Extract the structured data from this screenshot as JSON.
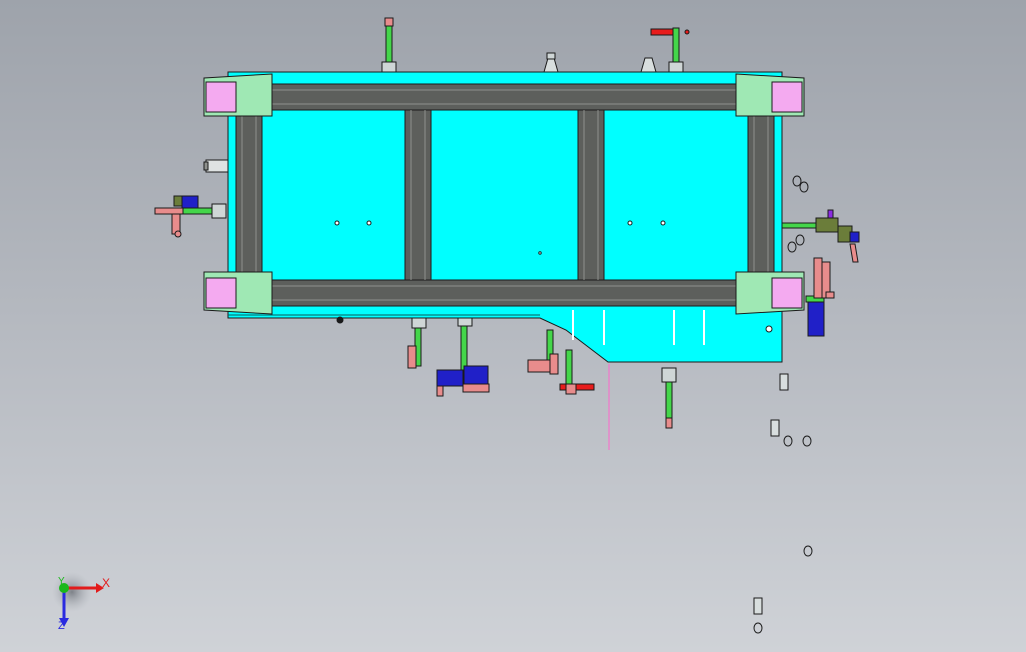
{
  "view": {
    "background_top": "#9ea3ab",
    "background_bottom": "#cfd2d7"
  },
  "model": {
    "plate_color": "#00ffff",
    "frame_color": "#5d5f5c",
    "corner_block_color": "#9fe8b4",
    "corner_pad_color": "#f4aaf0",
    "clamp_arm_color": "#44d64a",
    "clamp_body_color": "#e88c8c",
    "cylinder_color": "#2020c8",
    "handle_color": "#e81c1c",
    "bracket_color": "#6b7d3a"
  },
  "triad": {
    "x_label": "X",
    "y_label": "Y",
    "z_label": "Z",
    "x_color": "#e21b1b",
    "y_color": "#19b819",
    "z_color": "#2a2ae0"
  }
}
